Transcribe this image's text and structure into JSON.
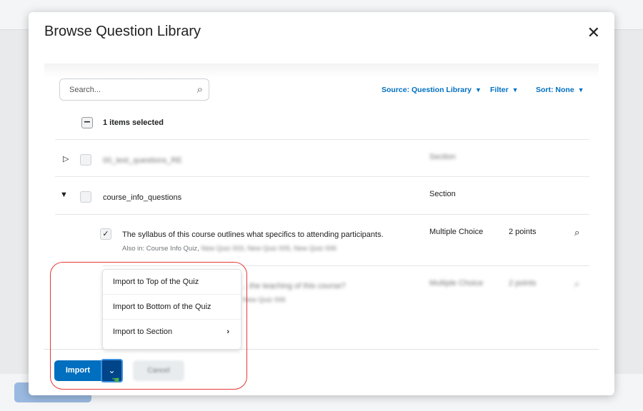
{
  "modal": {
    "title": "Browse Question Library",
    "close_icon": "close-icon"
  },
  "toolbar": {
    "search_placeholder": "Search...",
    "source": "Source: Question Library",
    "filter": "Filter",
    "sort": "Sort: None"
  },
  "selection": {
    "count_label": "1 items selected"
  },
  "rows": [
    {
      "name": "00_test_questions_RE",
      "type": "Section",
      "expanded": false,
      "blurred": true
    },
    {
      "name": "course_info_questions",
      "type": "Section",
      "expanded": true
    },
    {
      "question": "The syllabus of this course outlines what specifics to attending participants.",
      "also_in": "Also in: Course Info Quiz,",
      "also_in_blurred": "New Quiz 003, New Quiz 005, New Quiz 006",
      "type": "Multiple Choice",
      "points": "2 points",
      "checked": true
    },
    {
      "question": "...the teaching of this course?",
      "also_in": "New Quiz 006",
      "type": "Multiple Choice",
      "points": "2 points",
      "blurred": true
    }
  ],
  "import_menu": {
    "items": [
      "Import to Top of the Quiz",
      "Import to Bottom of the Quiz",
      "Import to Section"
    ]
  },
  "footer": {
    "import": "Import",
    "cancel": "Cancel"
  },
  "colors": {
    "primary": "#006fbf",
    "highlight": "#e53935"
  }
}
